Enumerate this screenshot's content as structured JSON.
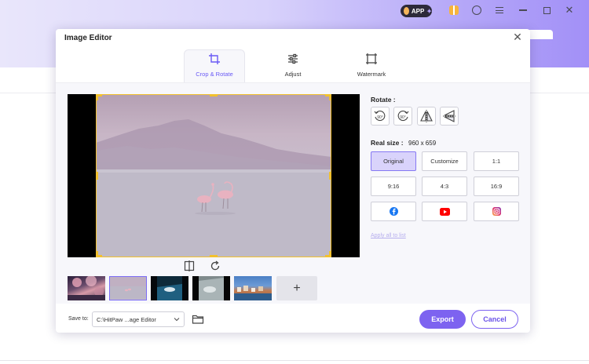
{
  "background_app": {
    "badge_label": "APP",
    "accent": "#a290f7"
  },
  "dialog": {
    "title": "Image Editor",
    "close_icon": "close-icon",
    "tabs": [
      {
        "label": "Crop & Rotate",
        "icon": "crop-icon",
        "active": true
      },
      {
        "label": "Adjust",
        "icon": "sliders-icon",
        "active": false
      },
      {
        "label": "Watermark",
        "icon": "watermark-icon",
        "active": false
      }
    ],
    "rotate": {
      "label": "Rotate :",
      "buttons": [
        {
          "name": "rotate-left-90-button",
          "text": "90°"
        },
        {
          "name": "rotate-right-90-button",
          "text": "90°"
        },
        {
          "name": "flip-horizontal-button",
          "text": ""
        },
        {
          "name": "flip-vertical-button",
          "text": ""
        }
      ]
    },
    "real_size": {
      "label": "Real size :",
      "value": "960 x 659"
    },
    "ratio_options": [
      {
        "label": "Original",
        "active": true
      },
      {
        "label": "Customize",
        "active": false
      },
      {
        "label": "1:1",
        "active": false
      },
      {
        "label": "9:16",
        "active": false
      },
      {
        "label": "4:3",
        "active": false
      },
      {
        "label": "16:9",
        "active": false
      }
    ],
    "social_options": [
      {
        "icon": "facebook-icon",
        "color": "#1877f2"
      },
      {
        "icon": "youtube-icon",
        "color": "#ff0000"
      },
      {
        "icon": "instagram-icon",
        "color": "#d6249f"
      }
    ],
    "apply_all": "Apply all to list",
    "footer": {
      "save_to_label": "Save to:",
      "path": "C:\\HitPaw ...age Editor",
      "export_label": "Export",
      "cancel_label": "Cancel"
    },
    "thumbnails": [
      {
        "name": "cherry-blossom",
        "selected": false
      },
      {
        "name": "flamingos",
        "selected": true
      },
      {
        "name": "underwater",
        "selected": false
      },
      {
        "name": "seal",
        "selected": false
      },
      {
        "name": "coastal-town",
        "selected": false
      }
    ],
    "add_label": "+",
    "crop_color": "#f2c12e"
  }
}
